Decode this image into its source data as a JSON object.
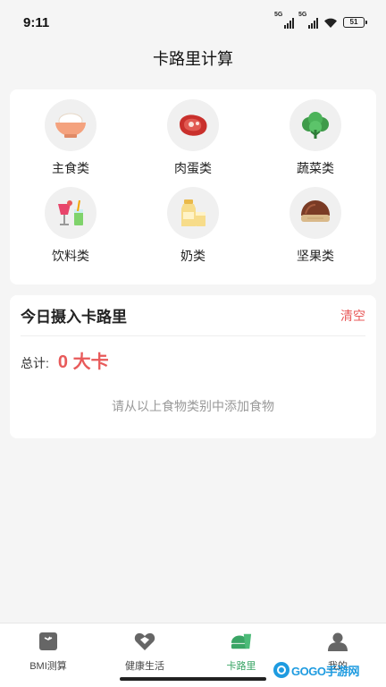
{
  "status_bar": {
    "time": "9:11",
    "network_1": "5G",
    "network_2": "5G",
    "battery": "51"
  },
  "page": {
    "title": "卡路里计算"
  },
  "categories": [
    {
      "label": "主食类",
      "icon": "rice-bowl-icon"
    },
    {
      "label": "肉蛋类",
      "icon": "meat-icon"
    },
    {
      "label": "蔬菜类",
      "icon": "vegetable-icon"
    },
    {
      "label": "饮料类",
      "icon": "drinks-icon"
    },
    {
      "label": "奶类",
      "icon": "milk-icon"
    },
    {
      "label": "坚果类",
      "icon": "nut-icon"
    }
  ],
  "intake": {
    "title": "今日摄入卡路里",
    "clear_label": "清空",
    "total_label": "总计:",
    "total_value": "0 大卡",
    "empty_hint": "请从以上食物类别中添加食物"
  },
  "tabs": [
    {
      "label": "BMI测算",
      "icon": "scale-icon",
      "active": false
    },
    {
      "label": "健康生活",
      "icon": "heart-icon",
      "active": false
    },
    {
      "label": "卡路里",
      "icon": "calorie-icon",
      "active": true
    },
    {
      "label": "我的",
      "icon": "user-icon",
      "active": false
    }
  ],
  "watermark": {
    "text": "GOGO手游网"
  },
  "colors": {
    "accent_red": "#e85a5a",
    "active_tab_green": "#3aa565",
    "background": "#f5f5f5"
  }
}
